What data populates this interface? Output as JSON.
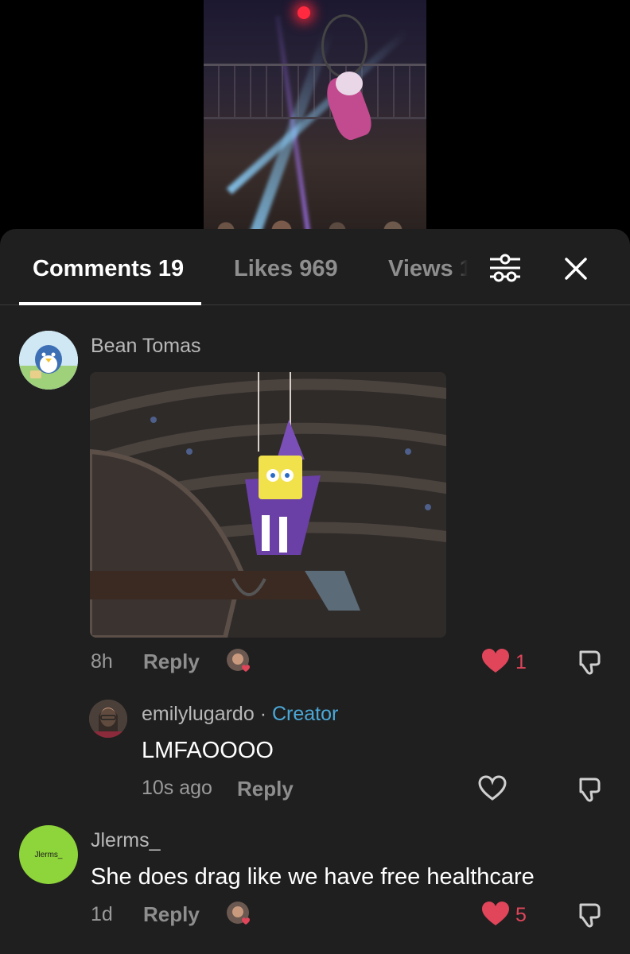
{
  "tabs": {
    "comments": "Comments 19",
    "likes": "Likes 969",
    "views": "Views 1"
  },
  "comments": [
    {
      "username": "Bean Tomas",
      "time": "8h",
      "reply_label": "Reply",
      "likes": "1",
      "liked": true,
      "has_gif": true
    },
    {
      "username": "Jlerms_",
      "avatar_text": "Jlerms_",
      "text": "She does drag like we have free healthcare",
      "time": "1d",
      "reply_label": "Reply",
      "likes": "5",
      "liked": true
    }
  ],
  "reply": {
    "username": "emilylugardo",
    "separator": " · ",
    "badge": "Creator",
    "text": "LMFAOOOO",
    "time": "10s ago",
    "reply_label": "Reply",
    "liked": false
  },
  "colors": {
    "sheet_bg": "#1f1f1f",
    "like_red": "#e0455a",
    "creator_blue": "#4aa8d8",
    "jlerms_avatar": "#8ed43b"
  },
  "icons": [
    "filter-icon",
    "close-icon",
    "heart-icon",
    "dislike-icon"
  ]
}
